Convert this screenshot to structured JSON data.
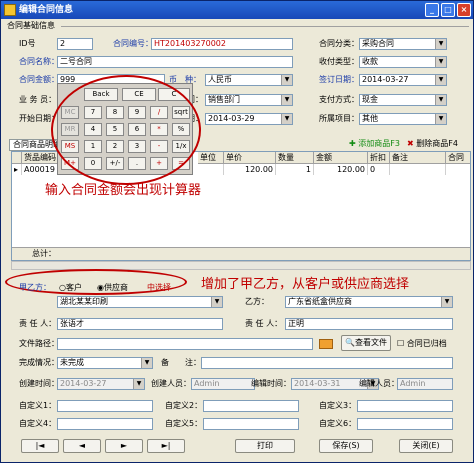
{
  "window": {
    "title": "编辑合同信息",
    "controls": [
      "_",
      "□",
      "×"
    ]
  },
  "basic_section": "合同基础信息",
  "fields": {
    "id_label": "ID号",
    "id_value": "2",
    "contract_no_label": "合同编号：",
    "contract_no_value": "HT201403270002",
    "category_label": "合同分类：",
    "category_value": "采购合同",
    "name_label": "合同名称：",
    "name_value": "二号合同",
    "payment_type_label": "收付类型：",
    "payment_type_value": "收款",
    "amount_label": "合同金额：",
    "amount_value": "999",
    "currency_label": "币　种：",
    "currency_value": "人民币",
    "sign_date_label": "签订日期：",
    "sign_date_value": "2014-03-27",
    "clerk_label": "业 务 员：",
    "dept_label": "部门：",
    "dept_value": "销售部门",
    "pay_method_label": "支付方式：",
    "pay_method_value": "现金",
    "start_date_label": "开始日期：",
    "end_date_label": "日期：",
    "end_date_value": "2014-03-29",
    "industry_label": "所属项目：",
    "industry_value": "其他"
  },
  "calculator": {
    "rows": [
      [
        "Back",
        "CE",
        "C"
      ],
      [
        "MC",
        "7",
        "8",
        "9",
        "/",
        "sqrt"
      ],
      [
        "MR",
        "4",
        "5",
        "6",
        "*",
        "%"
      ],
      [
        "MS",
        "1",
        "2",
        "3",
        "-",
        "1/x"
      ],
      [
        "M+",
        "0",
        "+/-",
        ".",
        "+",
        "="
      ]
    ]
  },
  "tabs": {
    "products": "合同商品明细",
    "add_product": "添加商品F3",
    "delete_product": "删除商品F4"
  },
  "grid": {
    "headers": [
      "货品编码",
      "单位",
      "单价",
      "数量",
      "金额",
      "折扣",
      "备注",
      "合同"
    ],
    "row": [
      "A00019",
      "",
      "120.00",
      "1",
      "120.00",
      "0",
      ""
    ],
    "total_label": "总计："
  },
  "annotations": {
    "calc_note": "输入合同金额会出现计算器",
    "party_note": "增加了甲乙方，从客户或供应商选择"
  },
  "party": {
    "party_a_label": "甲乙方：",
    "option_customer": "客户",
    "option_supplier": "供应商",
    "choose_label": "中选择",
    "party_a_value": "湖北某某印刷",
    "party_b_label": "乙方：",
    "party_b_value": "广东省纸盒供应商",
    "resp_a_label": "责 任 人：",
    "resp_a_value": "张语才",
    "resp_b_label": "责 任 人：",
    "resp_b_value": "正明"
  },
  "file": {
    "path_label": "文件路径：",
    "view_label": "查看文件",
    "archived_label": "合同已归档"
  },
  "status": {
    "complete_label": "完成情况：",
    "complete_value": "未完成",
    "remark_label": "备　　注："
  },
  "audit": {
    "created_time_label": "创建时间：",
    "created_time_value": "2014-03-27",
    "creator_label": "创建人员：",
    "creator_value": "Admin",
    "edit_time_label": "编辑时间：",
    "edit_time_value": "2014-03-31",
    "editor_label": "编辑人员：",
    "editor_value": "Admin"
  },
  "custom": {
    "c1": "自定义1：",
    "c2": "自定义2：",
    "c3": "自定义3：",
    "c4": "自定义4：",
    "c5": "自定义5：",
    "c6": "自定义6："
  },
  "footer": {
    "first": "|◄",
    "prev": "◄",
    "next": "►",
    "last": "►|",
    "print": "打印",
    "save": "保存(S)",
    "close": "关闭(E)"
  }
}
